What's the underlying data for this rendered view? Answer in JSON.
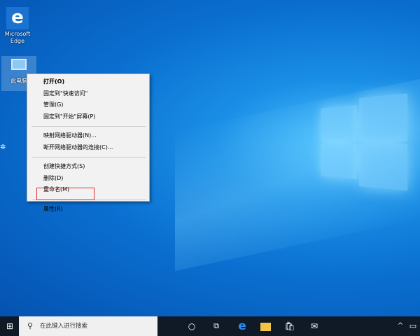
{
  "desktop": {
    "icons": [
      {
        "label": "Microsoft Edge"
      },
      {
        "label": "此电脑"
      }
    ]
  },
  "context_menu": {
    "groups": [
      [
        "打开(O)",
        "固定到\"快速访问\"",
        "管理(G)",
        "固定到\"开始\"屏幕(P)"
      ],
      [
        "映射网络驱动器(N)...",
        "断开网络驱动器的连接(C)..."
      ],
      [
        "创建快捷方式(S)",
        "删除(D)",
        "重命名(M)"
      ],
      [
        "属性(R)"
      ]
    ],
    "highlighted": "属性(R)"
  },
  "taskbar": {
    "search_placeholder": "在此键入进行搜索"
  },
  "colors": {
    "highlight": "#e0302f",
    "taskbar": "#101a26"
  }
}
